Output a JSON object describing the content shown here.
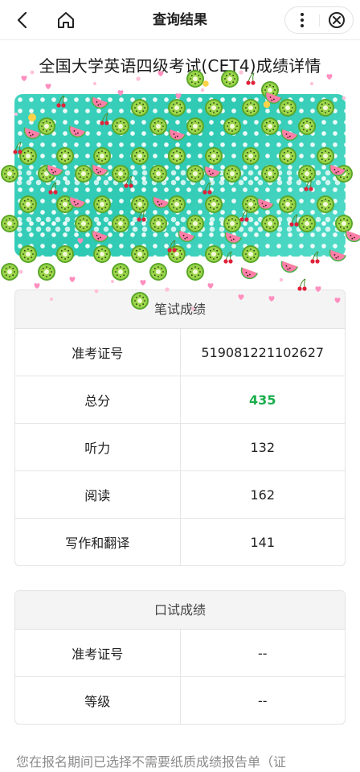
{
  "nav": {
    "title": "查询结果",
    "icons": {
      "back": "back-chevron-icon",
      "home": "home-icon",
      "more": "more-dots-icon",
      "close": "close-circle-icon"
    }
  },
  "heading": "全国大学英语四级考试(CET4)成绩详情",
  "banner": {
    "decoration": "fruit-confetti",
    "colors": {
      "background": "#3fd3bf",
      "kiwi": "#7cc83a",
      "watermelon": "#ff7ea8"
    }
  },
  "written": {
    "title": "笔试成绩",
    "rows": [
      {
        "label": "准考证号",
        "value": "519081221102627"
      },
      {
        "label": "总分",
        "value": "435"
      },
      {
        "label": "听力",
        "value": "132"
      },
      {
        "label": "阅读",
        "value": "162"
      },
      {
        "label": "写作和翻译",
        "value": "141"
      }
    ]
  },
  "oral": {
    "title": "口试成绩",
    "rows": [
      {
        "label": "准考证号",
        "value": "--"
      },
      {
        "label": "等级",
        "value": "--"
      }
    ]
  },
  "footnote": "您在报名期间已选择不需要纸质成绩报告单（证",
  "colors": {
    "accent_total": "#1aad4b",
    "header_bg": "#f4f4f4",
    "border": "#e3e3e3"
  }
}
